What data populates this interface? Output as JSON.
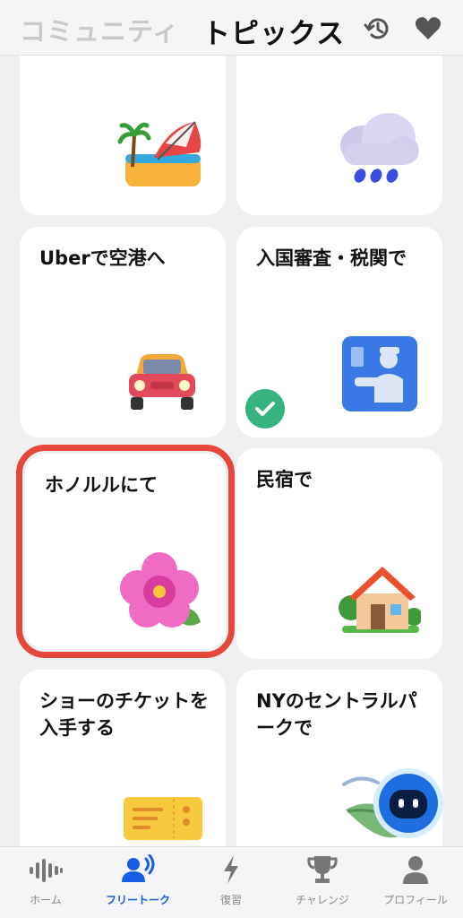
{
  "header": {
    "tab_community": "コミュニティ",
    "tab_topics": "トピックス"
  },
  "cards": [
    {
      "title": "",
      "emoji": "beach-umbrella-icon"
    },
    {
      "title": "",
      "emoji": "rain-cloud-icon"
    },
    {
      "title": "Uberで空港へ",
      "emoji": "car-icon"
    },
    {
      "title": "入国審査・税関で",
      "emoji": "passport-control-icon",
      "completed": true
    },
    {
      "title": "ホノルルにて",
      "emoji": "hibiscus-icon",
      "selected": true
    },
    {
      "title": "民宿で",
      "emoji": "house-icon"
    },
    {
      "title": "ショーのチケットを入手する",
      "emoji": "ticket-icon"
    },
    {
      "title": "NYのセントラルパークで",
      "emoji": "leaf-icon"
    }
  ],
  "bottom_nav": [
    {
      "label": "ホーム",
      "icon": "waveform-icon"
    },
    {
      "label": "フリートーク",
      "icon": "people-talking-icon",
      "active": true
    },
    {
      "label": "復習",
      "icon": "lightning-icon"
    },
    {
      "label": "チャレンジ",
      "icon": "trophy-icon"
    },
    {
      "label": "プロフィール",
      "icon": "person-icon"
    }
  ],
  "colors": {
    "accent": "#1a5ce6",
    "selected_outline": "#e5473d",
    "check_green": "#36b37e"
  }
}
